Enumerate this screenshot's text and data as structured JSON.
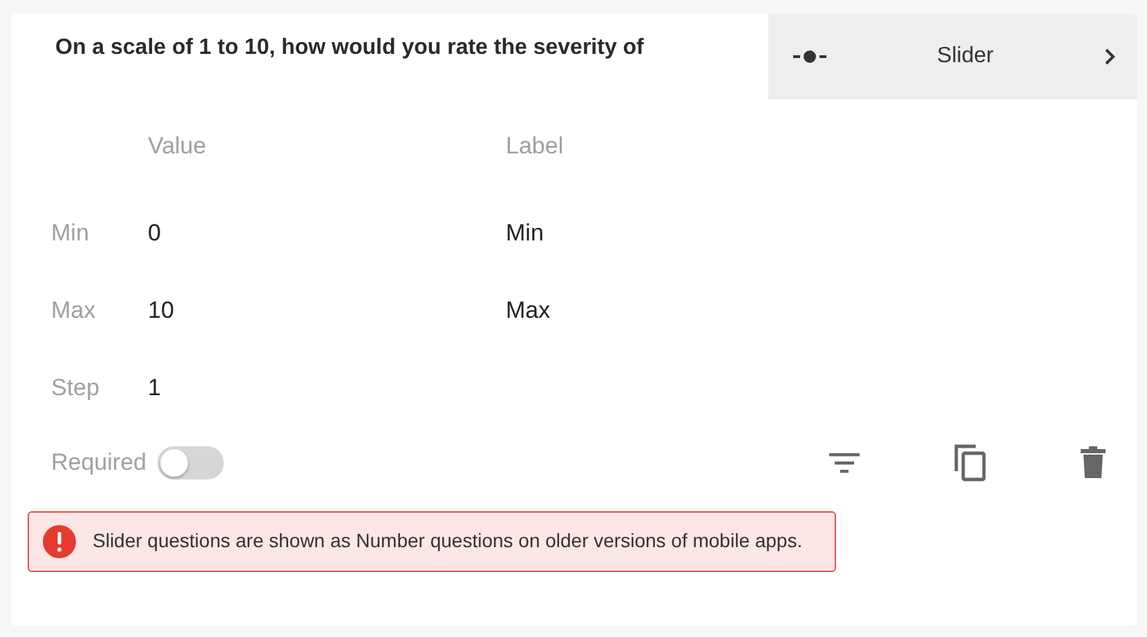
{
  "question": {
    "text": "On a scale of 1 to 10, how would you rate the severity of"
  },
  "type_selector": {
    "label": "Slider"
  },
  "columns": [
    "Value",
    "Label"
  ],
  "rows": [
    {
      "name": "Min",
      "value": "0",
      "label": "Min"
    },
    {
      "name": "Max",
      "value": "10",
      "label": "Max"
    },
    {
      "name": "Step",
      "value": "1"
    }
  ],
  "required": {
    "label": "Required",
    "on": false
  },
  "alert": {
    "text": "Slider questions are shown as Number questions on older versions of mobile apps."
  }
}
